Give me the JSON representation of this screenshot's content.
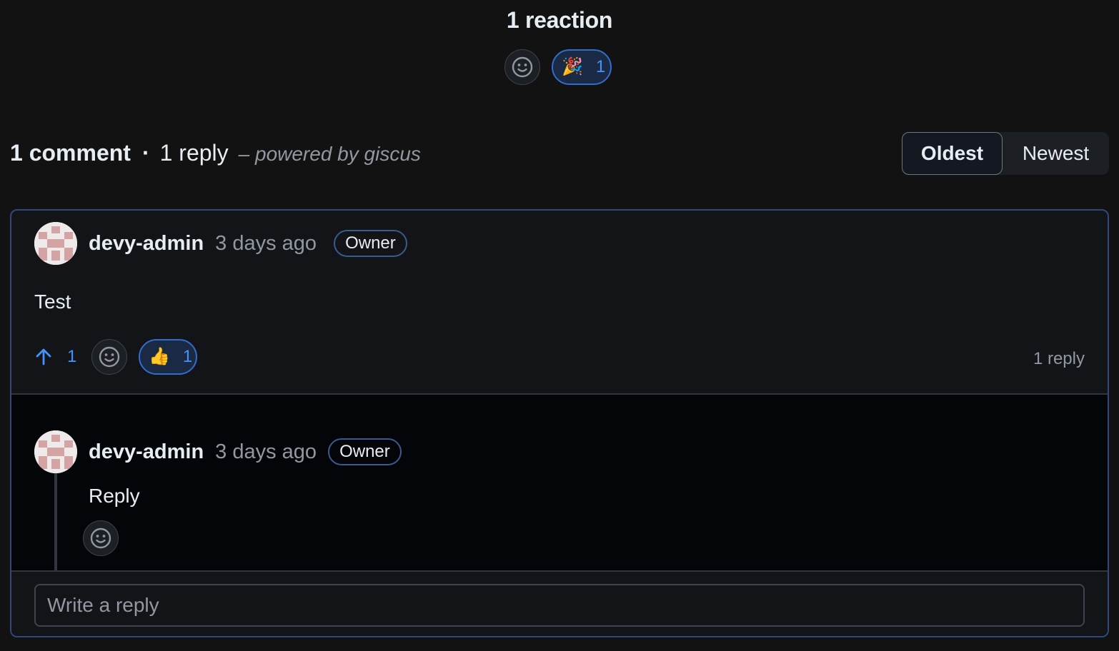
{
  "reactions": {
    "title": "1 reaction",
    "add_icon": "smiley-icon",
    "items": [
      {
        "emoji": "🎉",
        "count": "1",
        "color": "#4493f8"
      }
    ]
  },
  "summary": {
    "comment_count": "1 comment",
    "separator": "·",
    "reply_count": "1 reply",
    "powered_by": "– powered by giscus"
  },
  "sort": {
    "oldest": "Oldest",
    "newest": "Newest",
    "selected": "Oldest"
  },
  "comment": {
    "author": "devy-admin",
    "time": "3 days ago",
    "badge": "Owner",
    "body": "Test",
    "upvotes": "1",
    "reaction": {
      "emoji": "👍",
      "count": "1"
    },
    "reply_count": "1 reply"
  },
  "reply": {
    "author": "devy-admin",
    "time": "3 days ago",
    "badge": "Owner",
    "body": "Reply"
  },
  "composer": {
    "placeholder": "Write a reply"
  },
  "colors": {
    "accent": "#4493f8",
    "background": "#121212",
    "card_border": "#2f4a7a"
  }
}
